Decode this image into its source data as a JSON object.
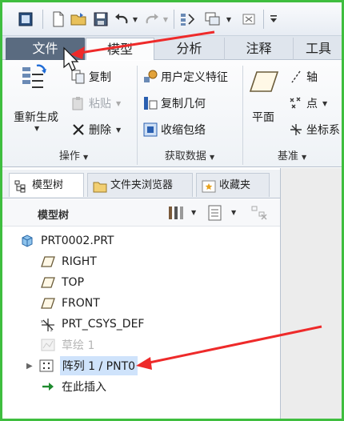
{
  "tabs": [
    {
      "label": "文件",
      "name": "tab-file"
    },
    {
      "label": "模型",
      "name": "tab-model"
    },
    {
      "label": "分析",
      "name": "tab-analysis"
    },
    {
      "label": "注释",
      "name": "tab-annotate"
    },
    {
      "label": "工具",
      "name": "tab-tools"
    }
  ],
  "ribbon": {
    "operations": {
      "regenerate": "重新生成",
      "copy": "复制",
      "paste": "粘贴",
      "delete": "删除",
      "group_label": "操作"
    },
    "get_data": {
      "user_defined_feature": "用户定义特征",
      "copy_geometry": "复制几何",
      "shrinkwrap": "收缩包络",
      "group_label": "获取数据"
    },
    "datum": {
      "plane": "平面",
      "axis": "轴",
      "point": "点",
      "coordinate_system": "坐标系",
      "group_label": "基准"
    }
  },
  "panel_tabs": {
    "model_tree": "模型树",
    "folder_browser": "文件夹浏览器",
    "favorites": "收藏夹"
  },
  "tree": {
    "title": "模型树",
    "items": [
      {
        "label": "PRT0002.PRT",
        "icon": "part-icon"
      },
      {
        "label": "RIGHT",
        "icon": "datum-plane-icon"
      },
      {
        "label": "TOP",
        "icon": "datum-plane-icon"
      },
      {
        "label": "FRONT",
        "icon": "datum-plane-icon"
      },
      {
        "label": "PRT_CSYS_DEF",
        "icon": "csys-icon"
      },
      {
        "label": "草绘 1",
        "icon": "sketch-icon",
        "state": "suppressed"
      },
      {
        "label": "阵列 1 / PNT0",
        "icon": "pattern-icon",
        "state": "selected"
      },
      {
        "label": "在此插入",
        "icon": "insert-here-arrow-icon"
      }
    ]
  },
  "colors": {
    "annotation_arrow": "#ee2a2a",
    "window_frame": "#3fbe3f",
    "file_tab_bg": "#5a6b80",
    "selection_bg": "#cfe3fb"
  }
}
